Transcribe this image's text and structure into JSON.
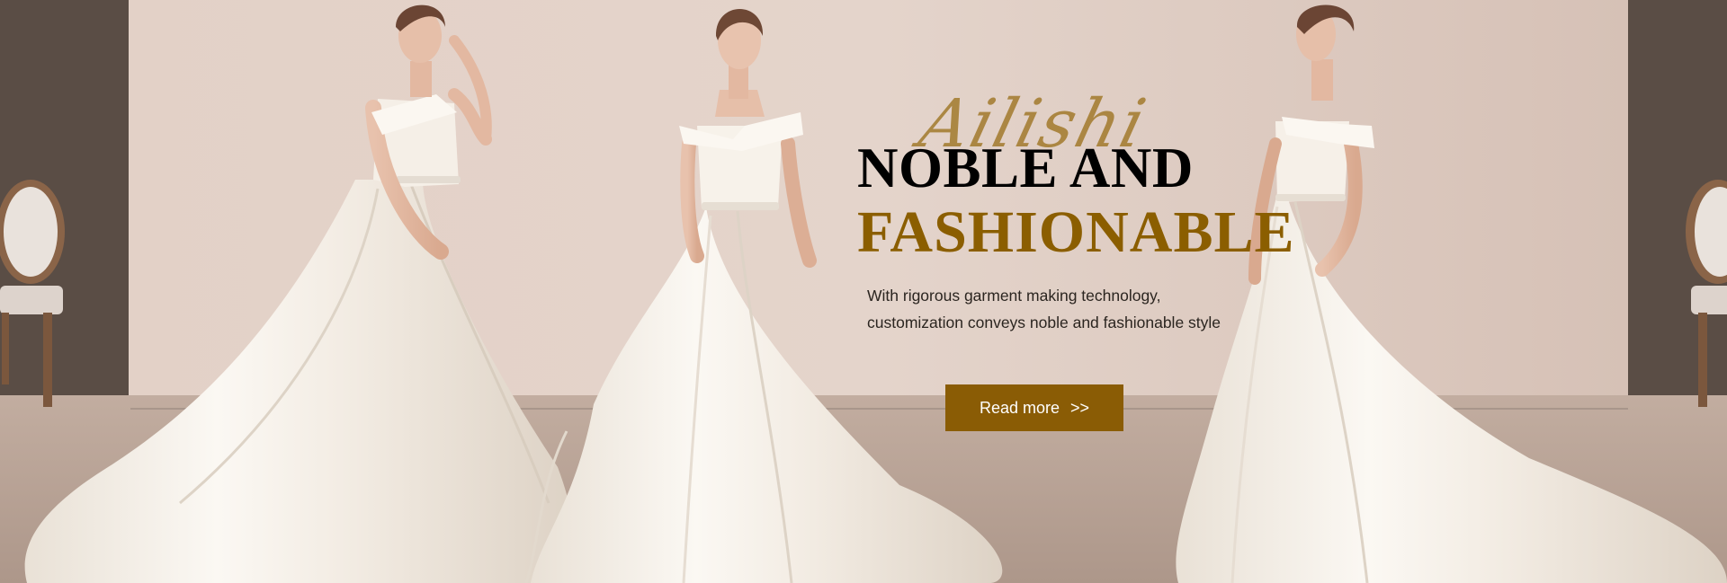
{
  "banner": {
    "brand_script": "Ailishi",
    "headline_line1": "NOBLE AND",
    "headline_line2": "FASHIONABLE",
    "description_line1": "With rigorous garment making technology,",
    "description_line2": "customization conveys noble and fashionable style",
    "cta_label": "Read more",
    "cta_arrow": ">>"
  },
  "colors": {
    "backdrop": "#dcc8bf",
    "accent_gold": "#8b5e00",
    "headline_black": "#000000",
    "button_bg": "#8a5c05",
    "dress_white": "#f6f1ea"
  }
}
